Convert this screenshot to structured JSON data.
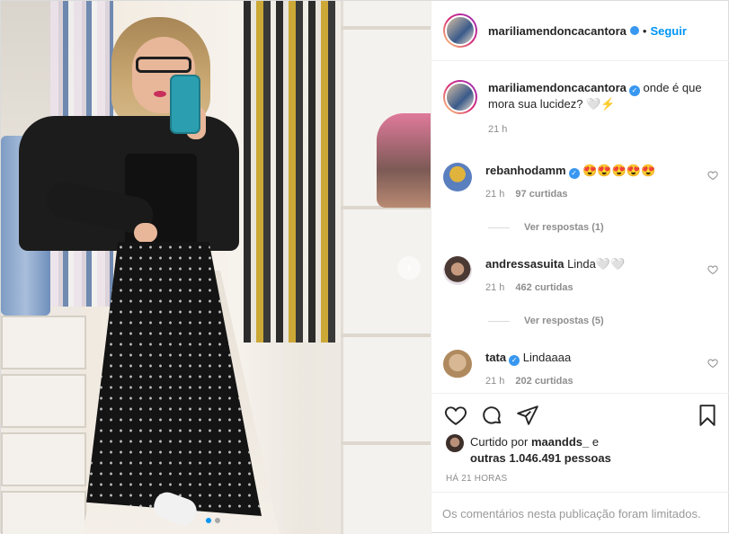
{
  "post": {
    "author": "mariliamendoncacantora",
    "separator": "•",
    "follow_label": "Seguir",
    "caption": "onde é que mora sua lucidez? 🤍⚡",
    "caption_time": "21 h"
  },
  "comments": [
    {
      "user": "rebanhodamm",
      "verified": true,
      "text": "😍😍😍😍😍",
      "time": "21 h",
      "likes": "97 curtidas",
      "replies": "Ver respostas (1)"
    },
    {
      "user": "andressasuita",
      "verified": false,
      "text": "Linda🤍🤍",
      "time": "21 h",
      "likes": "462 curtidas",
      "replies": "Ver respostas (5)"
    },
    {
      "user": "tata",
      "verified": true,
      "text": "Lindaaaa",
      "time": "21 h",
      "likes": "202 curtidas"
    }
  ],
  "liked": {
    "prefix": "Curtido por",
    "user": "maandds_",
    "and": "e",
    "others": "outras 1.046.491 pessoas"
  },
  "time_ago": "HÁ 21 HORAS",
  "footer_text": "Os comentários nesta publicação foram limitados.",
  "carousel": {
    "current": 1,
    "total": 2
  },
  "icons": {
    "like": "heart-icon",
    "comment": "comment-icon",
    "share": "share-icon",
    "save": "bookmark-icon",
    "next": "chevron-right-icon",
    "verified": "verified-badge-icon"
  },
  "colors": {
    "link": "#0095f6",
    "verified": "#3897f0",
    "muted": "#8e8e8e"
  }
}
